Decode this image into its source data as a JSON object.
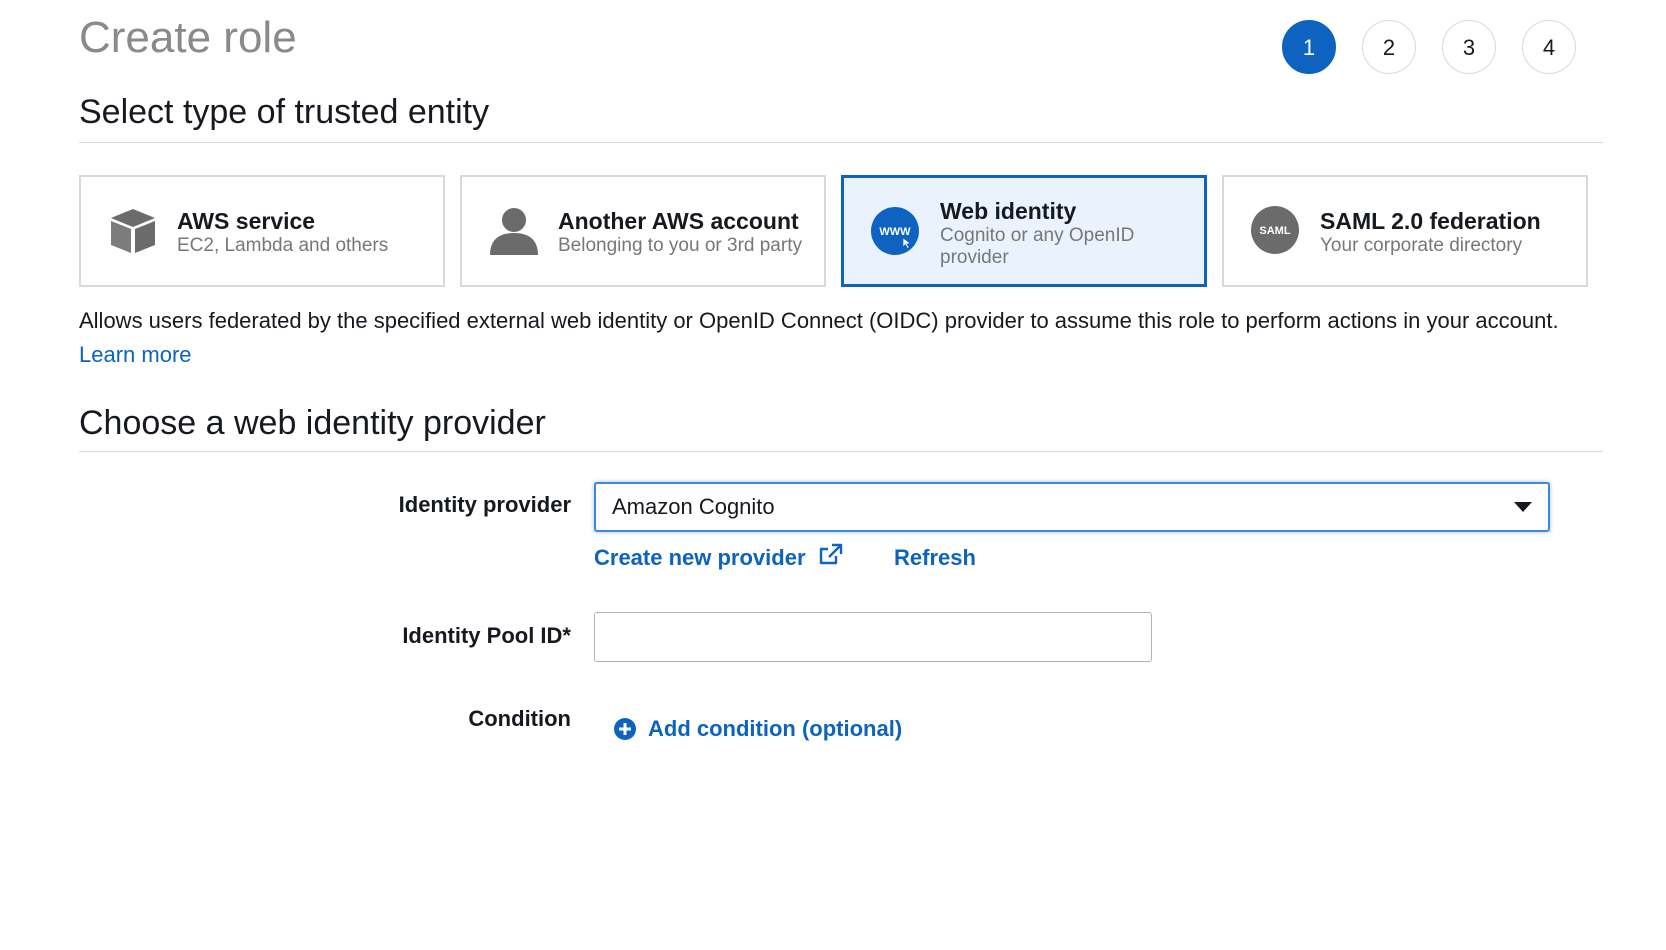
{
  "page": {
    "title": "Create role"
  },
  "steps": [
    "1",
    "2",
    "3",
    "4"
  ],
  "active_step": "1",
  "trusted_entity": {
    "heading": "Select type of trusted entity",
    "options": [
      {
        "name": "AWS service",
        "description": "EC2, Lambda and others",
        "icon": "cube-icon",
        "selected": false
      },
      {
        "name": "Another AWS account",
        "description": "Belonging to you or 3rd party",
        "icon": "user-icon",
        "selected": false
      },
      {
        "name": "Web identity",
        "description": "Cognito or any OpenID provider",
        "icon": "www-globe-icon",
        "icon_text": "WWW",
        "selected": true
      },
      {
        "name": "SAML 2.0 federation",
        "description": "Your corporate directory",
        "icon": "saml-icon",
        "icon_text": "SAML",
        "selected": false
      }
    ],
    "description": "Allows users federated by the specified external web identity or OpenID Connect (OIDC) provider to assume this role to perform actions in your account.",
    "learn_more": "Learn more"
  },
  "web_identity": {
    "heading": "Choose a web identity provider",
    "identity_provider": {
      "label": "Identity provider",
      "value": "Amazon Cognito"
    },
    "create_provider_link": "Create new provider",
    "refresh_link": "Refresh",
    "identity_pool": {
      "label": "Identity Pool ID*",
      "value": ""
    },
    "condition": {
      "label": "Condition",
      "add_label": "Add condition (optional)"
    }
  },
  "colors": {
    "accent": "#0d63bf",
    "selected_card_bg": "#eaf3fd",
    "muted_text": "#777777",
    "border": "#d5dbdb"
  }
}
